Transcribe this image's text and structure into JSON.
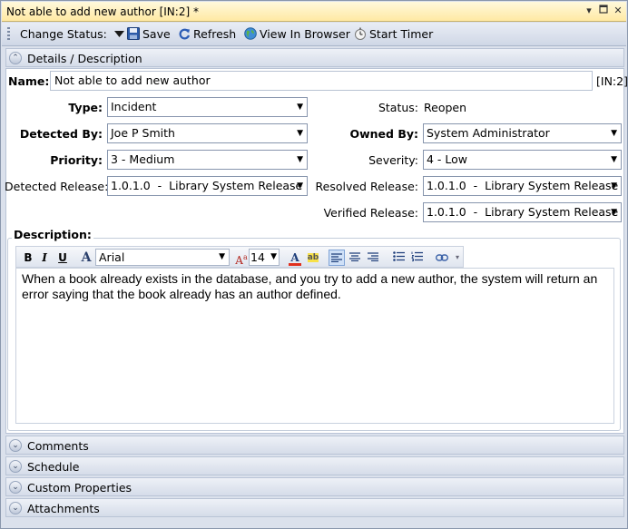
{
  "window": {
    "title": "Not able to add new author [IN:2] *",
    "controls": [
      "dropdown",
      "restore",
      "close"
    ]
  },
  "toolbar": {
    "change_status": "Change Status:",
    "save": "Save",
    "refresh": "Refresh",
    "view_in_browser": "View In Browser",
    "start_timer": "Start Timer"
  },
  "sections": {
    "details": "Details / Description",
    "comments": "Comments",
    "schedule": "Schedule",
    "custom_properties": "Custom Properties",
    "attachments": "Attachments"
  },
  "form": {
    "name_label": "Name:",
    "name_value": "Not able to add new author",
    "id_tag": "[IN:2]",
    "type_label": "Type:",
    "type_value": "Incident",
    "status_label": "Status:",
    "status_value": "Reopen",
    "detected_by_label": "Detected By:",
    "detected_by_value": "Joe P Smith",
    "owned_by_label": "Owned By:",
    "owned_by_value": "System Administrator",
    "priority_label": "Priority:",
    "priority_value": "3 - Medium",
    "severity_label": "Severity:",
    "severity_value": "4 - Low",
    "detected_release_label": "Detected Release:",
    "detected_release_value": "1.0.1.0  -  Library System Release",
    "resolved_release_label": "Resolved Release:",
    "resolved_release_value": "1.0.1.0  -  Library System Release",
    "verified_release_label": "Verified Release:",
    "verified_release_value": "1.0.1.0  -  Library System Release"
  },
  "description": {
    "label": "Description:",
    "font_name": "Arial",
    "font_size": "14",
    "text": "When a book already exists in the database, and you try to add a new author, the system will return an error saying that the book already has an author defined."
  },
  "colors": {
    "title_bar": "#ffe9a3",
    "toolbar": "#dbe1ec",
    "font_color_underline": "#e0301e",
    "highlight_yellow": "#f7e14a"
  }
}
